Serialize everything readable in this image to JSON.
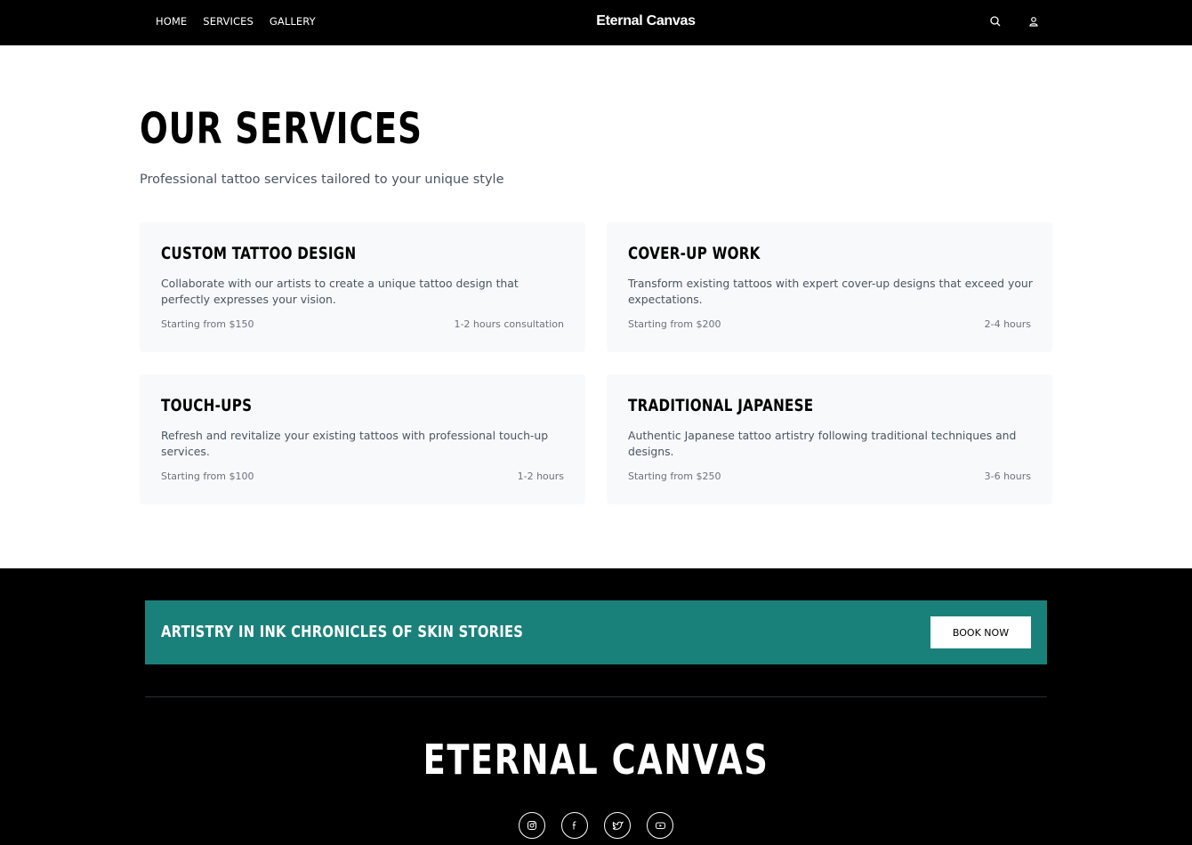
{
  "header": {
    "nav": [
      "HOME",
      "SERVICES",
      "GALLERY"
    ],
    "brand": "Eternal Canvas",
    "icons": [
      "search-icon",
      "user-icon"
    ]
  },
  "services": {
    "title": "OUR SERVICES",
    "subtitle": "Professional tattoo services tailored to your unique style",
    "cards": [
      {
        "title": "CUSTOM TATTOO DESIGN",
        "description": "Collaborate with our artists to create a unique tattoo design that perfectly expresses your vision.",
        "price": "Starting from $150",
        "duration": "1-2 hours consultation"
      },
      {
        "title": "COVER-UP WORK",
        "description": "Transform existing tattoos with expert cover-up designs that exceed your expectations.",
        "price": "Starting from $200",
        "duration": "2-4 hours"
      },
      {
        "title": "TOUCH-UPS",
        "description": "Refresh and revitalize your existing tattoos with professional touch-up services.",
        "price": "Starting from $100",
        "duration": "1-2 hours"
      },
      {
        "title": "TRADITIONAL JAPANESE",
        "description": "Authentic Japanese tattoo artistry following traditional techniques and designs.",
        "price": "Starting from $250",
        "duration": "3-6 hours"
      }
    ]
  },
  "footer": {
    "banner_text": "ARTISTRY IN INK CHRONICLES OF SKIN STORIES",
    "book_label": "BOOK NOW",
    "brand": "ETERNAL CANVAS",
    "socials": [
      "instagram-icon",
      "facebook-icon",
      "twitter-icon",
      "youtube-icon"
    ],
    "accent_color": "#1a817a"
  }
}
